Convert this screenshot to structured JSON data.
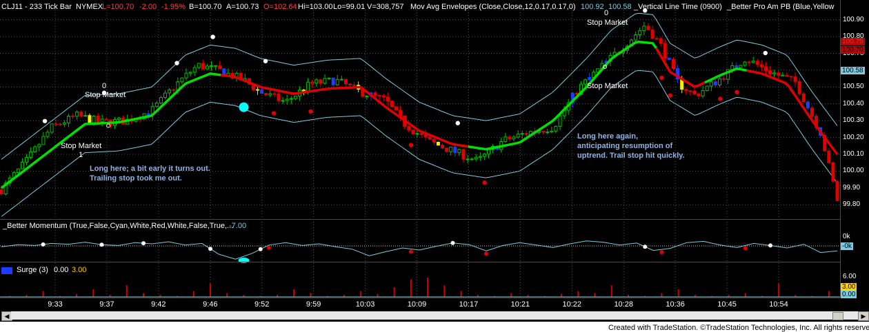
{
  "header": {
    "symbol": "CLJ11 - 233 Tick Bar",
    "exchange": "NYMEX",
    "last": "L=100.70",
    "change": "-2.00",
    "change_pct": "-1.95%",
    "bid": "B=100.70",
    "ask": "A=100.73",
    "open": "O=102.64",
    "high": "Hi=103.00",
    "low": "Lo=99.01",
    "volume": "V=308,757",
    "envelope_label": "Mov Avg Envelopes (Close,Close,12,0.17,0.17,0)",
    "envelope_upper": "100.92",
    "envelope_lower": "100.58",
    "vline_label": "_Vertical Line Time (0900)",
    "probar_label": "_Better Pro Am PB (Blue,Yellow"
  },
  "price_axis": [
    "100.90",
    "100.80",
    "100.70",
    "100.60",
    "100.50",
    "100.40",
    "100.30",
    "100.20",
    "100.10",
    "100.00",
    "99.90",
    "99.80"
  ],
  "price_tags": {
    "high_tag": "100.75",
    "last_tag": "100.70",
    "envelope_tag": "100.58"
  },
  "momentum": {
    "label": "_Better Momentum (True,False,Cyan,White,Red,White,False,True,...",
    "value": "-7.00",
    "axis_top": "0k",
    "axis_mid": "-0k"
  },
  "surge": {
    "label": "Surge (3)",
    "v1": "0.00",
    "v2": "3.00",
    "axis": [
      "6.00",
      "3.00",
      "0.00"
    ]
  },
  "time_axis": [
    "9:33",
    "9:37",
    "9:42",
    "9:46",
    "9:52",
    "9:59",
    "10:03",
    "10:09",
    "10:17",
    "10:21",
    "10:22",
    "10:28",
    "10:36",
    "10:45",
    "10:54"
  ],
  "annotations": {
    "first_trade": [
      "Long here; a bit early it turns out.",
      "Trailing stop took me out."
    ],
    "second_trade": [
      "Long here again,",
      "anticipating resumption of",
      "uptrend. Trail stop hit quickly."
    ],
    "stop1_top": "0",
    "stop1_label": "Stop Market",
    "stop2_label": "Stop Market",
    "stop2_bottom": "1",
    "stop3_top": "0",
    "stop3_label": "Stop Market",
    "stop4_label": "Stop Market"
  },
  "footer": {
    "credit": "Created with TradeStation. ©TradeStation Technologies, Inc. All rights reserved."
  },
  "colors": {
    "up_ma": "#00e000",
    "down_ma": "#e00000",
    "envelope": "#7ecbe0",
    "bull": "#00c000",
    "bear": "#e00000",
    "blue_bar": "#1e3cff",
    "yellow_bar": "#f0f000",
    "cyan": "#00ffff"
  },
  "chart_data": {
    "type": "candlestick",
    "title": "CLJ11 - 233 Tick Bar",
    "y_range": [
      99.74,
      100.96
    ],
    "close_path": [
      [
        0,
        99.89
      ],
      [
        0.03,
        100.06
      ],
      [
        0.06,
        100.26
      ],
      [
        0.09,
        100.33
      ],
      [
        0.12,
        100.29
      ],
      [
        0.15,
        100.3
      ],
      [
        0.18,
        100.36
      ],
      [
        0.21,
        100.52
      ],
      [
        0.235,
        100.63
      ],
      [
        0.26,
        100.6
      ],
      [
        0.29,
        100.54
      ],
      [
        0.31,
        100.47
      ],
      [
        0.34,
        100.41
      ],
      [
        0.37,
        100.52
      ],
      [
        0.4,
        100.54
      ],
      [
        0.43,
        100.47
      ],
      [
        0.46,
        100.42
      ],
      [
        0.48,
        100.29
      ],
      [
        0.51,
        100.18
      ],
      [
        0.54,
        100.12
      ],
      [
        0.57,
        100.06
      ],
      [
        0.6,
        100.18
      ],
      [
        0.63,
        100.23
      ],
      [
        0.66,
        100.26
      ],
      [
        0.69,
        100.49
      ],
      [
        0.72,
        100.63
      ],
      [
        0.75,
        100.77
      ],
      [
        0.77,
        100.87
      ],
      [
        0.79,
        100.74
      ],
      [
        0.81,
        100.52
      ],
      [
        0.83,
        100.45
      ],
      [
        0.86,
        100.55
      ],
      [
        0.89,
        100.67
      ],
      [
        0.92,
        100.59
      ],
      [
        0.95,
        100.53
      ],
      [
        0.98,
        100.23
      ],
      [
        1.0,
        99.83
      ]
    ],
    "ma_path": [
      [
        0,
        99.9
      ],
      [
        0.05,
        100.09
      ],
      [
        0.1,
        100.28
      ],
      [
        0.14,
        100.29
      ],
      [
        0.18,
        100.33
      ],
      [
        0.22,
        100.52
      ],
      [
        0.25,
        100.58
      ],
      [
        0.28,
        100.56
      ],
      [
        0.31,
        100.5
      ],
      [
        0.35,
        100.46
      ],
      [
        0.39,
        100.49
      ],
      [
        0.43,
        100.5
      ],
      [
        0.46,
        100.38
      ],
      [
        0.5,
        100.24
      ],
      [
        0.54,
        100.16
      ],
      [
        0.58,
        100.13
      ],
      [
        0.62,
        100.17
      ],
      [
        0.66,
        100.3
      ],
      [
        0.7,
        100.5
      ],
      [
        0.73,
        100.67
      ],
      [
        0.76,
        100.77
      ],
      [
        0.78,
        100.76
      ],
      [
        0.8,
        100.59
      ],
      [
        0.83,
        100.5
      ],
      [
        0.86,
        100.57
      ],
      [
        0.88,
        100.61
      ],
      [
        0.91,
        100.58
      ],
      [
        0.94,
        100.52
      ],
      [
        0.97,
        100.3
      ],
      [
        1.0,
        100.1
      ]
    ],
    "ma_up_ranges": [
      [
        0,
        0.26
      ],
      [
        0.555,
        0.78
      ],
      [
        0.84,
        0.89
      ]
    ],
    "envelope_offset": 0.17,
    "momentum_path": [
      [
        0,
        -0.2
      ],
      [
        0.02,
        0.3
      ],
      [
        0.04,
        0.1
      ],
      [
        0.06,
        0.6
      ],
      [
        0.08,
        0.4
      ],
      [
        0.1,
        0.9
      ],
      [
        0.12,
        0.3
      ],
      [
        0.14,
        0.1
      ],
      [
        0.16,
        0.8
      ],
      [
        0.18,
        0.5
      ],
      [
        0.2,
        1.0
      ],
      [
        0.22,
        0.2
      ],
      [
        0.24,
        0.6
      ],
      [
        0.26,
        -2.0
      ],
      [
        0.28,
        -3.2
      ],
      [
        0.3,
        -1.8
      ],
      [
        0.32,
        0.2
      ],
      [
        0.34,
        0.8
      ],
      [
        0.36,
        0.1
      ],
      [
        0.38,
        0.5
      ],
      [
        0.4,
        -0.2
      ],
      [
        0.42,
        -0.8
      ],
      [
        0.44,
        -2.4
      ],
      [
        0.46,
        -1.4
      ],
      [
        0.48,
        -0.5
      ],
      [
        0.5,
        -1.0
      ],
      [
        0.52,
        -0.1
      ],
      [
        0.54,
        0.7
      ],
      [
        0.56,
        0.3
      ],
      [
        0.58,
        -1.2
      ],
      [
        0.6,
        0.1
      ],
      [
        0.62,
        0.8
      ],
      [
        0.64,
        0.2
      ],
      [
        0.66,
        -0.4
      ],
      [
        0.68,
        0.5
      ],
      [
        0.7,
        1.2
      ],
      [
        0.72,
        0.9
      ],
      [
        0.74,
        0.2
      ],
      [
        0.76,
        0.7
      ],
      [
        0.78,
        -1.1
      ],
      [
        0.8,
        -0.6
      ],
      [
        0.82,
        0.8
      ],
      [
        0.84,
        1.1
      ],
      [
        0.86,
        0.2
      ],
      [
        0.88,
        -0.4
      ],
      [
        0.9,
        0.6
      ],
      [
        0.92,
        0.1
      ],
      [
        0.94,
        -0.5
      ],
      [
        0.96,
        0.4
      ],
      [
        0.98,
        -1.6
      ],
      [
        1.0,
        -1.2
      ]
    ],
    "surge_bars": [
      0.05,
      0.1,
      0.3,
      0.05,
      0.15,
      0.4,
      0.1,
      0.6,
      0.2,
      0.1,
      0.05,
      0.3,
      0.7,
      0.2,
      0.1,
      0.05,
      0.1,
      0.4,
      0.2,
      0.05,
      0.1,
      0.3,
      0.15,
      0.5,
      0.9,
      1.0,
      0.6,
      0.3,
      0.1,
      0.05,
      0.2,
      0.1,
      0.05,
      0.15,
      0.3,
      0.2,
      0.6,
      0.1,
      0.05,
      0.2,
      0.4,
      0.1,
      0.05,
      0.1,
      0.2,
      0.05,
      0.7,
      0.1,
      0.05,
      0.3
    ]
  }
}
